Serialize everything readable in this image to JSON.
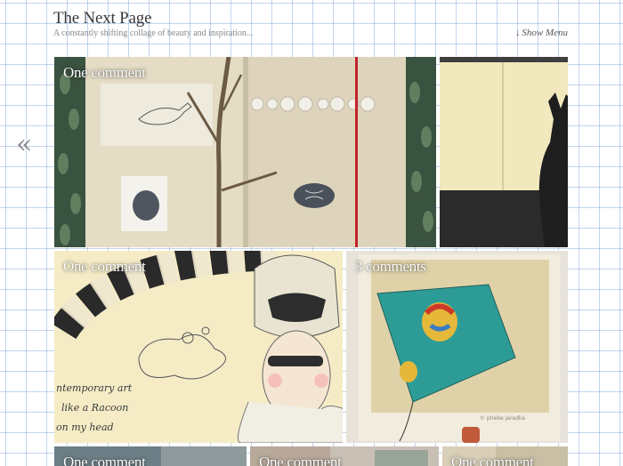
{
  "header": {
    "title": "The Next Page",
    "tagline": "A constantly shifting collage of beauty and inspiration...",
    "menu_arrow": "↓",
    "menu_label": "Show Menu"
  },
  "nav": {
    "prev_glyph": "«"
  },
  "tiles": [
    {
      "comments": "One comment"
    },
    {
      "comments": ""
    },
    {
      "comments": "One comment"
    },
    {
      "comments": "3 comments"
    },
    {
      "comments": "One comment"
    },
    {
      "comments": "One comment"
    },
    {
      "comments": "One comment"
    }
  ],
  "artwork": {
    "kite_credit": "© phebe jaradlia",
    "handwriting_line1": "ntemporary art",
    "handwriting_line2": "like a Racoon",
    "handwriting_line3": "on my head"
  }
}
